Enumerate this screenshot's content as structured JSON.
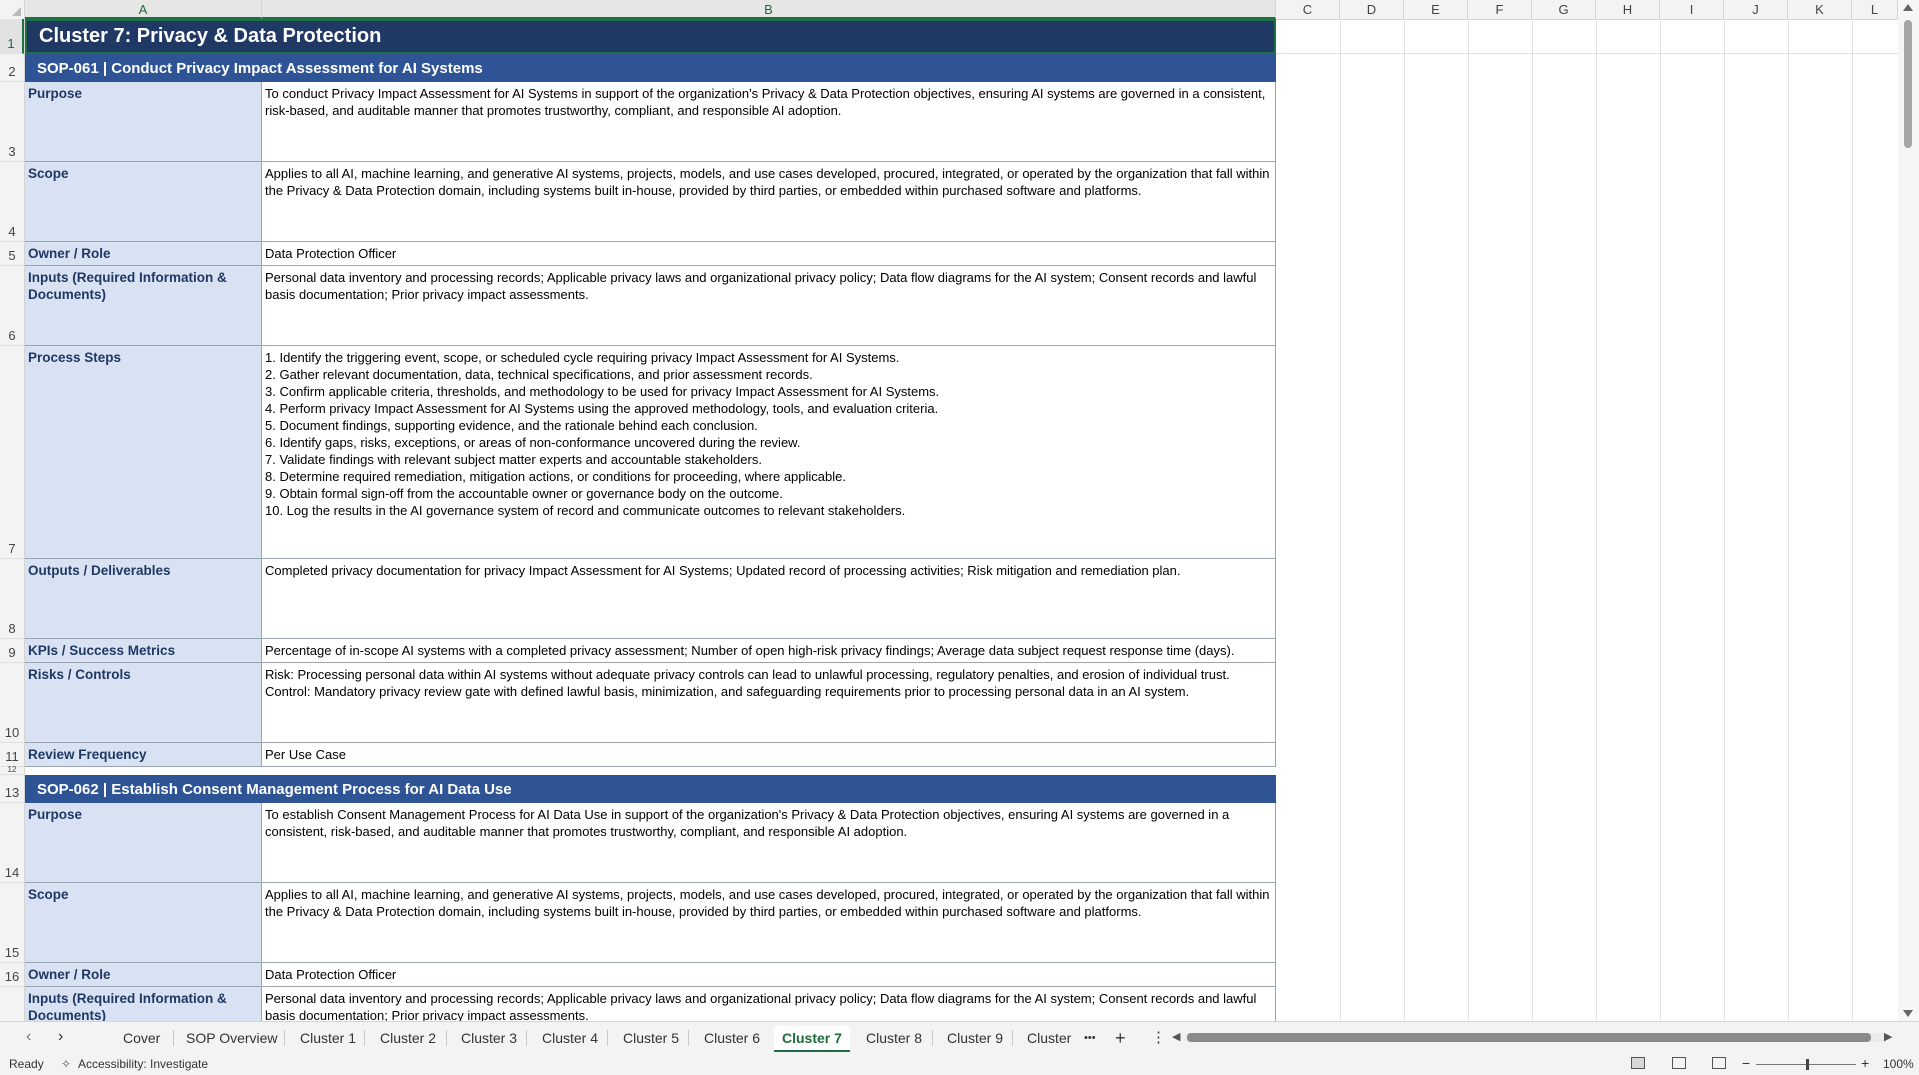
{
  "columns": [
    "A",
    "B",
    "C",
    "D",
    "E",
    "F",
    "G",
    "H",
    "I",
    "J",
    "K",
    "L"
  ],
  "rows": [
    "1",
    "2",
    "3",
    "4",
    "5",
    "6",
    "7",
    "8",
    "9",
    "10",
    "11",
    "12",
    "13",
    "14",
    "15",
    "16"
  ],
  "sheet_title": "Cluster 7: Privacy & Data Protection",
  "sop1": {
    "heading": "SOP-061  |  Conduct Privacy Impact Assessment for AI Systems",
    "purpose_label": "Purpose",
    "purpose": "To conduct Privacy Impact Assessment for AI Systems in support of the organization's Privacy & Data Protection objectives, ensuring AI systems are governed in a consistent, risk-based, and auditable manner that promotes trustworthy, compliant, and responsible AI adoption.",
    "scope_label": "Scope",
    "scope": "Applies to all AI, machine learning, and generative AI systems, projects, models, and use cases developed, procured, integrated, or operated by the organization that fall within the Privacy & Data Protection domain, including systems built in-house, provided by third parties, or embedded within purchased software and platforms.",
    "owner_label": "Owner / Role",
    "owner": "Data Protection Officer",
    "inputs_label": "Inputs (Required Information & Documents)",
    "inputs": "Personal data inventory and processing records; Applicable privacy laws and organizational privacy policy; Data flow diagrams for the AI system; Consent records and lawful basis documentation; Prior privacy impact assessments.",
    "steps_label": "Process Steps",
    "steps": "1. Identify the triggering event, scope, or scheduled cycle requiring privacy Impact Assessment for AI Systems.\n2. Gather relevant documentation, data, technical specifications, and prior assessment records.\n3. Confirm applicable criteria, thresholds, and methodology to be used for privacy Impact Assessment for AI Systems.\n4. Perform privacy Impact Assessment for AI Systems using the approved methodology, tools, and evaluation criteria.\n5. Document findings, supporting evidence, and the rationale behind each conclusion.\n6. Identify gaps, risks, exceptions, or areas of non-conformance uncovered during the review.\n7. Validate findings with relevant subject matter experts and accountable stakeholders.\n8. Determine required remediation, mitigation actions, or conditions for proceeding, where applicable.\n9. Obtain formal sign-off from the accountable owner or governance body on the outcome.\n10. Log the results in the AI governance system of record and communicate outcomes to relevant stakeholders.",
    "outputs_label": "Outputs / Deliverables",
    "outputs": "Completed privacy documentation for privacy Impact Assessment for AI Systems; Updated record of processing activities; Risk mitigation and remediation plan.",
    "kpis_label": "KPIs / Success Metrics",
    "kpis": "Percentage of in-scope AI systems with a completed privacy assessment; Number of open high-risk privacy findings; Average data subject request response time (days).",
    "risks_label": "Risks / Controls",
    "risks": "Risk: Processing personal data within AI systems without adequate privacy controls can lead to unlawful processing, regulatory penalties, and erosion of individual trust.\nControl: Mandatory privacy review gate with defined lawful basis, minimization, and safeguarding requirements prior to processing personal data in an AI system.",
    "review_label": "Review Frequency",
    "review": "Per Use Case"
  },
  "sop2": {
    "heading": "SOP-062  |  Establish Consent Management Process for AI Data Use",
    "purpose_label": "Purpose",
    "purpose": "To establish Consent Management Process for AI Data Use in support of the organization's Privacy & Data Protection objectives, ensuring AI systems are governed in a consistent, risk-based, and auditable manner that promotes trustworthy, compliant, and responsible AI adoption.",
    "scope_label": "Scope",
    "scope": "Applies to all AI, machine learning, and generative AI systems, projects, models, and use cases developed, procured, integrated, or operated by the organization that fall within the Privacy & Data Protection domain, including systems built in-house, provided by third parties, or embedded within purchased software and platforms.",
    "owner_label": "Owner / Role",
    "owner": "Data Protection Officer",
    "inputs_label": "Inputs (Required Information & Documents)",
    "inputs": "Personal data inventory and processing records; Applicable privacy laws and organizational privacy policy; Data flow diagrams for the AI system; Consent records and lawful basis documentation; Prior privacy impact assessments."
  },
  "tabs": [
    "Cover",
    "SOP Overview",
    "Cluster 1",
    "Cluster 2",
    "Cluster 3",
    "Cluster 4",
    "Cluster 5",
    "Cluster 6",
    "Cluster 7",
    "Cluster 8",
    "Cluster 9",
    "Cluster "
  ],
  "tab_more": "•••",
  "tab_add": "+",
  "tab_menu": "⋮",
  "status": {
    "ready": "Ready",
    "accessibility": "Accessibility: Investigate",
    "zoom": "100%",
    "zoom_minus": "−",
    "zoom_plus": "+"
  }
}
